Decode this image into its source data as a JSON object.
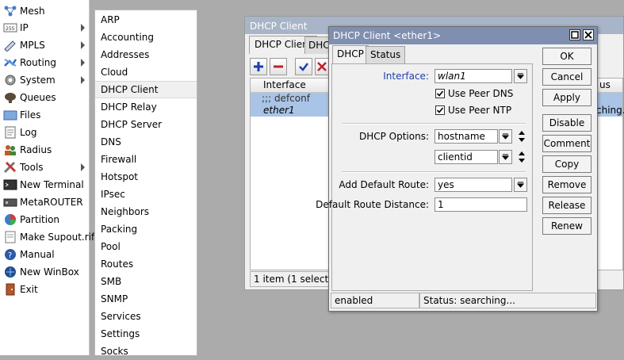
{
  "left_menu": {
    "items": [
      {
        "label": "Mesh",
        "icon": "mesh-icon",
        "arrow": false
      },
      {
        "label": "IP",
        "icon": "ip-icon",
        "arrow": true
      },
      {
        "label": "MPLS",
        "icon": "mpls-icon",
        "arrow": true
      },
      {
        "label": "Routing",
        "icon": "routing-icon",
        "arrow": true
      },
      {
        "label": "System",
        "icon": "gear-icon",
        "arrow": true
      },
      {
        "label": "Queues",
        "icon": "queues-icon",
        "arrow": false
      },
      {
        "label": "Files",
        "icon": "folder-icon",
        "arrow": false
      },
      {
        "label": "Log",
        "icon": "log-icon",
        "arrow": false
      },
      {
        "label": "Radius",
        "icon": "radius-icon",
        "arrow": false
      },
      {
        "label": "Tools",
        "icon": "tools-icon",
        "arrow": true
      },
      {
        "label": "New Terminal",
        "icon": "terminal-icon",
        "arrow": false
      },
      {
        "label": "MetaROUTER",
        "icon": "metarouter-icon",
        "arrow": false
      },
      {
        "label": "Partition",
        "icon": "partition-icon",
        "arrow": false
      },
      {
        "label": "Make Supout.rif",
        "icon": "document-icon",
        "arrow": false
      },
      {
        "label": "Manual",
        "icon": "manual-icon",
        "arrow": false
      },
      {
        "label": "New WinBox",
        "icon": "winbox-icon",
        "arrow": false
      },
      {
        "label": "Exit",
        "icon": "exit-icon",
        "arrow": false
      }
    ]
  },
  "submenu": {
    "items": [
      "ARP",
      "Accounting",
      "Addresses",
      "Cloud",
      "DHCP Client",
      "DHCP Relay",
      "DHCP Server",
      "DNS",
      "Firewall",
      "Hotspot",
      "IPsec",
      "Neighbors",
      "Packing",
      "Pool",
      "Routes",
      "SMB",
      "SNMP",
      "Services",
      "Settings",
      "Socks"
    ],
    "selected": "DHCP Client"
  },
  "list_window": {
    "title": "DHCP Client",
    "tabs": [
      "DHCP Client",
      "DHC"
    ],
    "toolbar_icons": [
      "add-icon",
      "remove-icon",
      "enable-check-icon",
      "disable-x-icon"
    ],
    "columns": [
      "Interface",
      "us"
    ],
    "rows": [
      {
        "interface": ";;; defconf",
        "status": ""
      },
      {
        "interface": "ether1",
        "status": "ching..."
      }
    ],
    "status": "1 item (1 selected)"
  },
  "dialog": {
    "title": "DHCP Client <ether1>",
    "tabs": [
      "DHCP",
      "Status"
    ],
    "interface_label": "Interface:",
    "interface_value": "wlan1",
    "use_peer_dns_label": "Use Peer DNS",
    "use_peer_dns": true,
    "use_peer_ntp_label": "Use Peer NTP",
    "use_peer_ntp": true,
    "dhcp_options_label": "DHCP Options:",
    "dhcp_options": [
      "hostname",
      "clientid"
    ],
    "add_default_route_label": "Add Default Route:",
    "add_default_route_value": "yes",
    "default_route_distance_label": "Default Route Distance:",
    "default_route_distance_value": "1",
    "buttons": {
      "ok": "OK",
      "cancel": "Cancel",
      "apply": "Apply",
      "disable": "Disable",
      "comment": "Comment",
      "copy": "Copy",
      "remove": "Remove",
      "release": "Release",
      "renew": "Renew"
    },
    "status_left": "enabled",
    "status_right": "Status: searching..."
  },
  "colors": {
    "interface_label": "#1f3faa",
    "selected_row": "#a9c4e6",
    "dialog_title": "#7f8fb0",
    "inactive_title": "#a8b4c8"
  }
}
